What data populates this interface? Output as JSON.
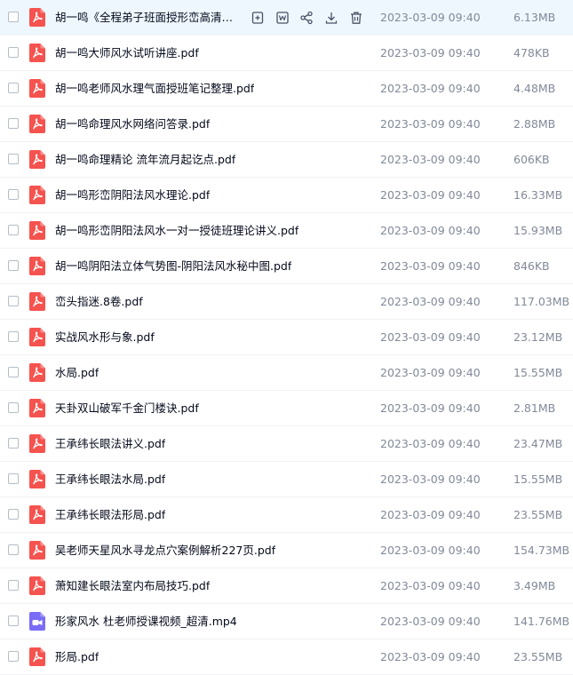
{
  "colors": {
    "pdf_icon": "#f5534f",
    "video_icon": "#7b6cf6",
    "hover_row": "#eef7fe",
    "action_icon": "#4a5166",
    "meta_text": "#818999",
    "name_text": "#03081a"
  },
  "row_actions": [
    {
      "name": "collect-icon"
    },
    {
      "name": "open-in-pdf-icon"
    },
    {
      "name": "share-icon"
    },
    {
      "name": "download-icon"
    },
    {
      "name": "delete-icon"
    }
  ],
  "files": [
    {
      "name": "胡一鸣《全程弟子班面授形峦高清讲义》.pdf",
      "date": "2023-03-09 09:40",
      "size": "6.13MB",
      "type": "pdf",
      "hover": true
    },
    {
      "name": "胡一鸣大师风水试听讲座.pdf",
      "date": "2023-03-09 09:40",
      "size": "478KB",
      "type": "pdf"
    },
    {
      "name": "胡一鸣老师风水理气面授班笔记整理.pdf",
      "date": "2023-03-09 09:40",
      "size": "4.48MB",
      "type": "pdf"
    },
    {
      "name": "胡一鸣命理风水网络问答录.pdf",
      "date": "2023-03-09 09:40",
      "size": "2.88MB",
      "type": "pdf"
    },
    {
      "name": "胡一鸣命理精论 流年流月起讫点.pdf",
      "date": "2023-03-09 09:40",
      "size": "606KB",
      "type": "pdf"
    },
    {
      "name": "胡一鸣形峦阴阳法风水理论.pdf",
      "date": "2023-03-09 09:40",
      "size": "16.33MB",
      "type": "pdf"
    },
    {
      "name": "胡一鸣形峦阴阳法风水一对一授徒班理论讲义.pdf",
      "date": "2023-03-09 09:40",
      "size": "15.93MB",
      "type": "pdf"
    },
    {
      "name": "胡一鸣阴阳法立体气势图-阴阳法风水秘中图.pdf",
      "date": "2023-03-09 09:40",
      "size": "846KB",
      "type": "pdf"
    },
    {
      "name": "峦头指迷.8卷.pdf",
      "date": "2023-03-09 09:40",
      "size": "117.03MB",
      "type": "pdf"
    },
    {
      "name": "实战风水形与象.pdf",
      "date": "2023-03-09 09:40",
      "size": "23.12MB",
      "type": "pdf"
    },
    {
      "name": "水局.pdf",
      "date": "2023-03-09 09:40",
      "size": "15.55MB",
      "type": "pdf"
    },
    {
      "name": "天卦双山破军千金门楼诀.pdf",
      "date": "2023-03-09 09:40",
      "size": "2.81MB",
      "type": "pdf"
    },
    {
      "name": "王承纬长眼法讲义.pdf",
      "date": "2023-03-09 09:40",
      "size": "23.47MB",
      "type": "pdf"
    },
    {
      "name": "王承纬长眼法水局.pdf",
      "date": "2023-03-09 09:40",
      "size": "15.55MB",
      "type": "pdf"
    },
    {
      "name": "王承纬长眼法形局.pdf",
      "date": "2023-03-09 09:40",
      "size": "23.55MB",
      "type": "pdf"
    },
    {
      "name": "吴老师天星风水寻龙点穴案例解析227页.pdf",
      "date": "2023-03-09 09:40",
      "size": "154.73MB",
      "type": "pdf"
    },
    {
      "name": "萧知建长眼法室内布局技巧.pdf",
      "date": "2023-03-09 09:40",
      "size": "3.49MB",
      "type": "pdf"
    },
    {
      "name": "形家风水 杜老师授课视频_超清.mp4",
      "date": "2023-03-09 09:40",
      "size": "141.76MB",
      "type": "video"
    },
    {
      "name": "形局.pdf",
      "date": "2023-03-09 09:40",
      "size": "23.55MB",
      "type": "pdf"
    }
  ]
}
